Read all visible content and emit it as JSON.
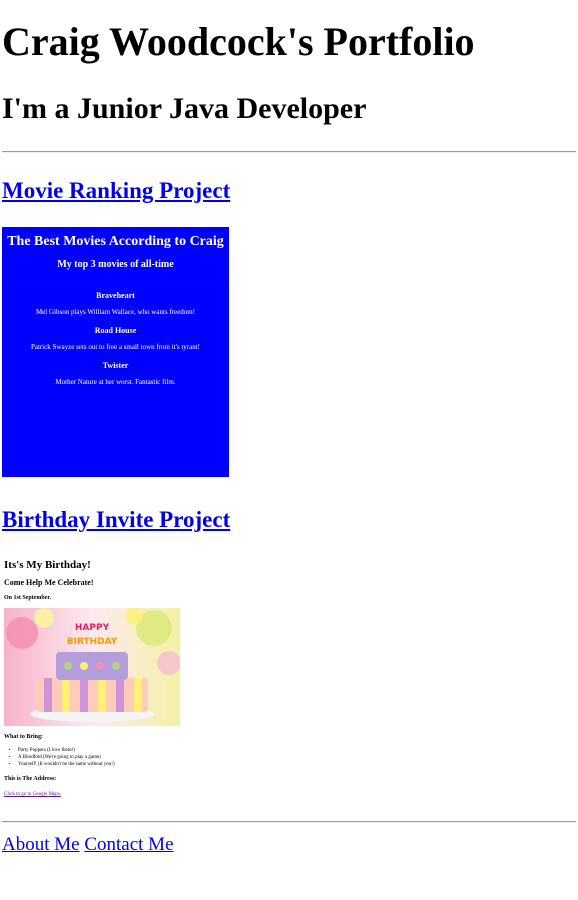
{
  "header": {
    "title": "Craig Woodcock's Portfolio",
    "subtitle": "I'm a Junior Java Developer"
  },
  "projects": [
    {
      "link_label": "Movie Ranking Project",
      "preview": {
        "background": "#0000ff",
        "title": "The Best Movies According to Craig",
        "subtitle": "My top 3 movies of all-time",
        "movies": [
          {
            "name": "Braveheart",
            "desc": "Mel Gibson plays William Wallace, who wants freedom!"
          },
          {
            "name": "Road House",
            "desc": "Patrick Swayze sets out to free a small town from it's tyrant!"
          },
          {
            "name": "Twister",
            "desc": "Mother Nature at her worst. Fantastic film."
          }
        ]
      }
    },
    {
      "link_label": "Birthday Invite Project",
      "preview": {
        "heading": "Its's My Birthday!",
        "subheading": "Come Help Me Celebrate!",
        "date": "On 1st September.",
        "cake_text": "HAPPY BIRTHDAY",
        "bring_heading": "What to Bring:",
        "bring_items": [
          "Party Poppers (I love them!)",
          "A Blindfold (We're going to play a game)",
          "Yourself! (It wouldn't be the same without you!)"
        ],
        "address_heading": "This is The Address:",
        "address_link": "Click to go to Google Maps."
      }
    }
  ],
  "footer": {
    "about_label": "About Me",
    "contact_label": "Contact Me"
  },
  "colors": {
    "link": "#0000ee",
    "visited_link": "#551a8b",
    "movie_bg": "#0000ff"
  }
}
